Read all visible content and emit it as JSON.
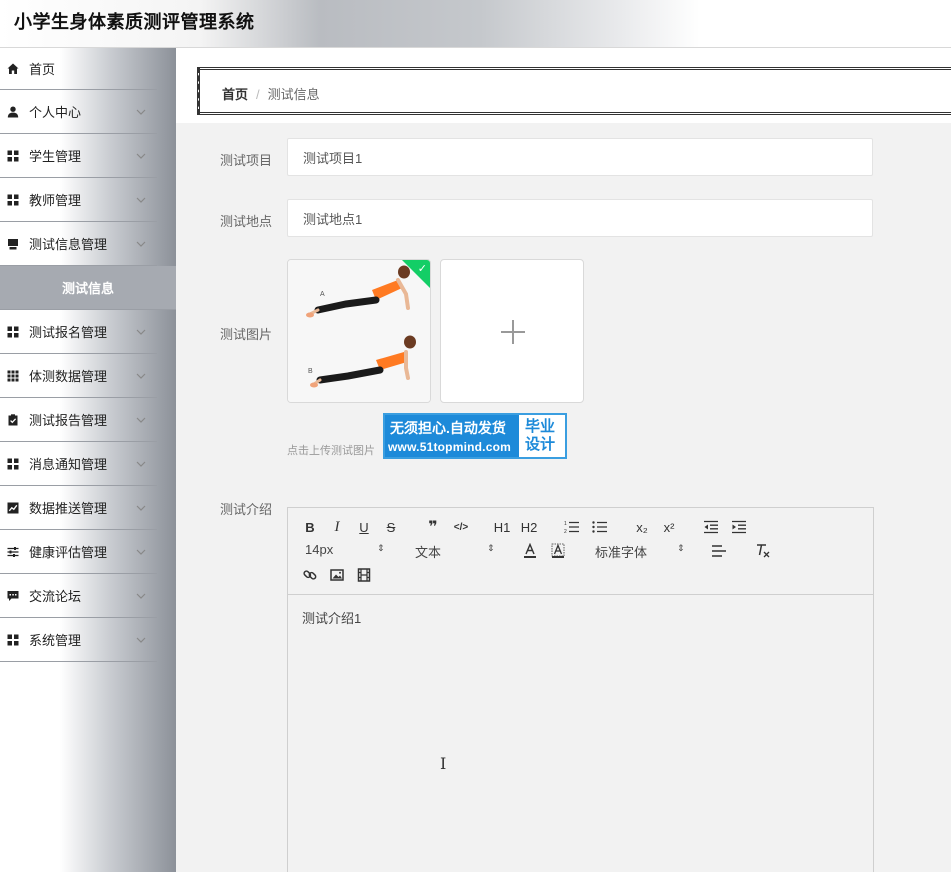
{
  "header": {
    "title": "小学生身体素质测评管理系统"
  },
  "sidebar": {
    "items": [
      {
        "label": "首页",
        "icon": "home-icon",
        "chevron": false
      },
      {
        "label": "个人中心",
        "icon": "user-icon",
        "chevron": true
      },
      {
        "label": "学生管理",
        "icon": "grid-icon",
        "chevron": true
      },
      {
        "label": "教师管理",
        "icon": "grid-icon",
        "chevron": true
      },
      {
        "label": "测试信息管理",
        "icon": "tray-icon",
        "chevron": true
      },
      {
        "label": "测试报名管理",
        "icon": "grid-icon",
        "chevron": true
      },
      {
        "label": "体测数据管理",
        "icon": "apps-icon",
        "chevron": true
      },
      {
        "label": "测试报告管理",
        "icon": "clipboard-check-icon",
        "chevron": true
      },
      {
        "label": "消息通知管理",
        "icon": "grid-icon",
        "chevron": true
      },
      {
        "label": "数据推送管理",
        "icon": "chart-icon",
        "chevron": true
      },
      {
        "label": "健康评估管理",
        "icon": "sliders-icon",
        "chevron": true
      },
      {
        "label": "交流论坛",
        "icon": "comment-icon",
        "chevron": true
      },
      {
        "label": "系统管理",
        "icon": "grid-icon",
        "chevron": true
      }
    ],
    "active_sub": "测试信息"
  },
  "breadcrumb": {
    "home": "首页",
    "separator": "/",
    "current": "测试信息"
  },
  "form": {
    "project": {
      "label": "测试项目",
      "value": "测试项目1"
    },
    "location": {
      "label": "测试地点",
      "value": "测试地点1"
    },
    "image": {
      "label": "测试图片",
      "hint": "点击上传测试图片"
    },
    "intro": {
      "label": "测试介绍",
      "content": "测试介绍1"
    }
  },
  "watermark": {
    "line1": "无须担心.自动发货",
    "line2": "www.51topmind.com",
    "right1": "毕业",
    "right2": "设计"
  },
  "editor": {
    "font_size": "14px",
    "header_select": "文本",
    "font_family": "标准字体",
    "buttons": [
      "B",
      "I",
      "U",
      "S",
      "❞",
      "</>",
      "H1",
      "H2",
      "ol",
      "ul",
      "x₂",
      "x²",
      "outdent",
      "indent"
    ]
  },
  "colors": {
    "accent_green": "#13ce66",
    "watermark_blue": "#1d8ad9"
  }
}
